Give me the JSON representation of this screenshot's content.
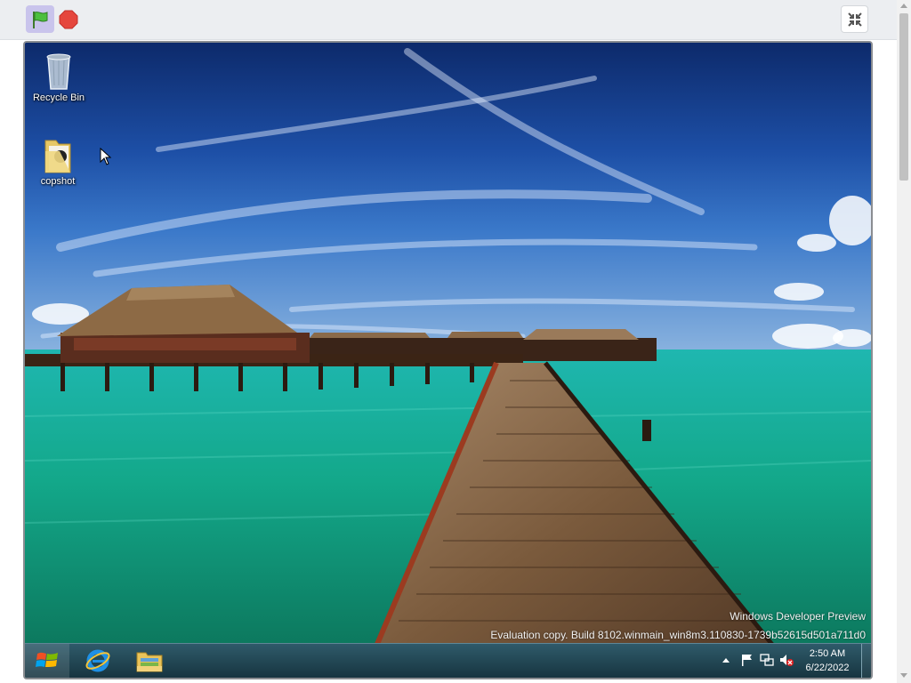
{
  "toolbar": {
    "green_flag_icon": "green-flag-icon",
    "stop_icon": "stop-sign-icon",
    "exit_fullscreen_icon": "compress-icon"
  },
  "colors": {
    "flag_button_bg": "#c9c4ec",
    "stop_red": "#e5463d",
    "taskbar": "#1f4450"
  },
  "desktop": {
    "icons": [
      {
        "label": "Recycle Bin",
        "icon": "recycle-bin-icon"
      },
      {
        "label": "copshot",
        "icon": "folder-icon"
      }
    ],
    "watermark": {
      "line1": "Windows Developer Preview",
      "line2": "Evaluation copy. Build 8102.winmain_win8m3.110830-1739b52615d501a711d0"
    }
  },
  "taskbar": {
    "start": "windows-start-icon",
    "apps": [
      {
        "name": "Internet Explorer",
        "icon": "internet-explorer-icon"
      },
      {
        "name": "Windows Explorer",
        "icon": "file-explorer-icon"
      }
    ],
    "tray": {
      "icons": [
        "show-hidden-icons-chevron",
        "action-center-flag-icon",
        "network-icon",
        "volume-muted-icon"
      ]
    },
    "clock": {
      "time": "2:50 AM",
      "date": "6/22/2022"
    }
  }
}
